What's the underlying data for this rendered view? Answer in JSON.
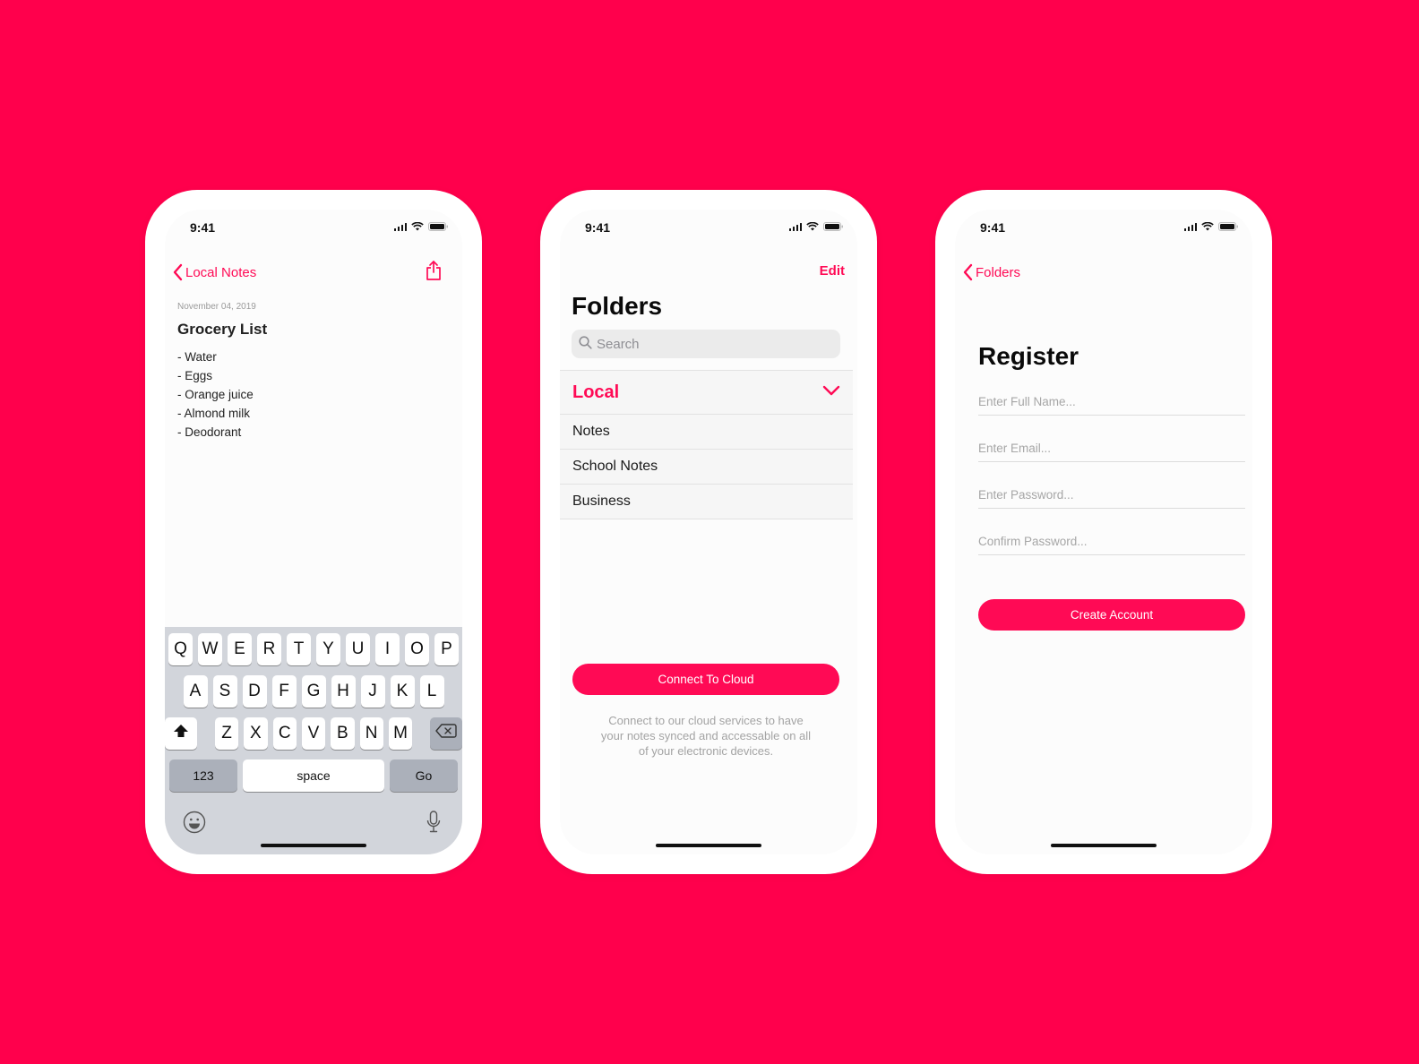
{
  "colors": {
    "background": "#FF004C",
    "accent": "#FF0A55",
    "keyboard_bg": "#D2D5DB"
  },
  "status_bar": {
    "time": "9:41",
    "icons": [
      "signal-icon",
      "wifi-icon",
      "battery-icon"
    ]
  },
  "note_screen": {
    "back_label": "Local Notes",
    "share_icon": "share-icon",
    "date": "November 04, 2019",
    "title": "Grocery List",
    "items": [
      "- Water",
      "- Eggs",
      "- Orange juice",
      "- Almond milk",
      "- Deodorant"
    ],
    "keyboard": {
      "row1": [
        "Q",
        "W",
        "E",
        "R",
        "T",
        "Y",
        "U",
        "I",
        "O",
        "P"
      ],
      "row2": [
        "A",
        "S",
        "D",
        "F",
        "G",
        "H",
        "J",
        "K",
        "L"
      ],
      "row3": [
        "Z",
        "X",
        "C",
        "V",
        "B",
        "N",
        "M"
      ],
      "numbers_label": "123",
      "space_label": "space",
      "go_label": "Go",
      "icons": [
        "shift-icon",
        "backspace-icon",
        "emoji-icon",
        "microphone-icon"
      ]
    }
  },
  "folders_screen": {
    "edit_label": "Edit",
    "title": "Folders",
    "search_placeholder": "Search",
    "section_label": "Local",
    "folders": [
      "Notes",
      "School Notes",
      "Business"
    ],
    "cloud_button": "Connect To Cloud",
    "cloud_description": "Connect to our cloud services to have your notes synced and accessable on all of your electronic devices."
  },
  "register_screen": {
    "back_label": "Folders",
    "title": "Register",
    "fields": [
      {
        "placeholder": "Enter Full Name..."
      },
      {
        "placeholder": "Enter Email..."
      },
      {
        "placeholder": "Enter Password..."
      },
      {
        "placeholder": "Confirm Password..."
      }
    ],
    "submit_label": "Create Account"
  }
}
